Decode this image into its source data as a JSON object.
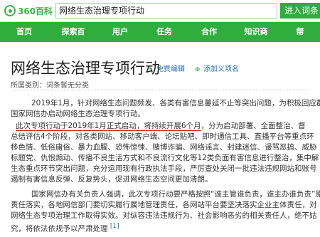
{
  "header": {
    "logo_text": "360百科",
    "search_value": "网络生态治理专项行动",
    "search_button": "进入词条"
  },
  "nav": {
    "items": [
      "首页",
      "探索百",
      "用户",
      "任务",
      "合作",
      "知识商",
      "帮"
    ]
  },
  "article": {
    "title": "网络生态治理专项行动",
    "edit_label": "免费编辑",
    "add_label": "添加义项名",
    "category": "所属类别：词条暂无分类",
    "para1_line1": "2019年1月，针对网络生态问题频发、各类有害信息蔓延不止等突出问题，为积极回应群众",
    "para1_line2": "国家网信办启动网络生态治理专项行动。",
    "para2_line1_hl": "此次专项行动于2019年1月正式启动，将持续开展6个月",
    "para2_line1_rest": "，分为启动部署、全面整治、督",
    "para2_line2": "总结评估4个阶段，对各类网站、移动客户端、论坛贴吧、即时通信工具、直播平台等重点环",
    "para2_line3": "移色情、低俗庸俗、暴力血腥、恐怖惊悚、赌博诈骗、网络谣言、封建迷信、谩骂恶搞、威胁",
    "para2_line4": "标题党、仇恨煽动、传播不良生活方式和不良流行文化等12类负面有害信息进行整治，集中解",
    "para2_line5": "生态重点环节突出问题，充分运用现有行政执法手段，严厉查处关闭一批违法违规网站和账号",
    "para2_line6": "遏制有害信息反弹、反复势头，促进网络生态空间更加清朗。",
    "para3_line1": "国家网信办有关负责人强调，此次专项行动要严格按照“谁主管谁负责，谁主办谁负责”原",
    "para3_line2": "责任落实，各地网信部门要切实履行属地管理责任，各网站平台要坚决落实企业主体责任，对",
    "para3_line3": "网络生态专项治理工作取得实效。对纵容违法违规行为、社会影响恶劣的相关责任人，绝不姑",
    "para3_line4": "究，将依法依规予以严肃处理",
    "ref": "[1]"
  }
}
